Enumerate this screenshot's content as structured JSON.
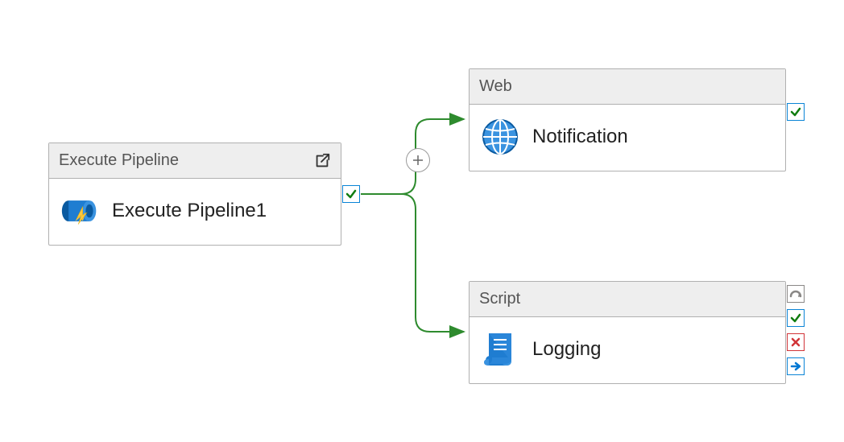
{
  "activities": {
    "execute_pipeline": {
      "type_label": "Execute Pipeline",
      "name": "Execute Pipeline1"
    },
    "web": {
      "type_label": "Web",
      "name": "Notification"
    },
    "script": {
      "type_label": "Script",
      "name": "Logging"
    }
  },
  "colors": {
    "success_green": "#107c10",
    "fail_red": "#d13438",
    "skip_gray": "#8a8886",
    "completion_blue": "#0078d4",
    "node_border": "#b0b0b0",
    "connector": "#2e8b2e"
  }
}
